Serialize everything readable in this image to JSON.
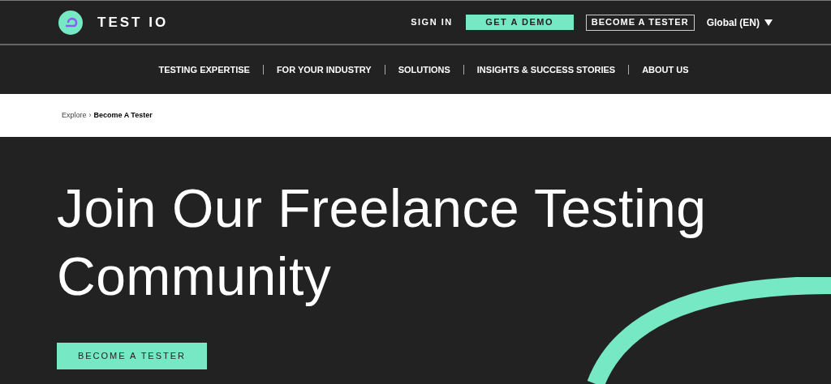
{
  "header": {
    "brand": "TEST IO",
    "sign_in": "SIGN IN",
    "demo_button": "GET A DEMO",
    "tester_button": "BECOME A TESTER",
    "language": "Global (EN)"
  },
  "nav": [
    "TESTING EXPERTISE",
    "FOR YOUR INDUSTRY",
    "SOLUTIONS",
    "INSIGHTS & SUCCESS STORIES",
    "ABOUT US"
  ],
  "breadcrumb": {
    "items": [
      "Explore",
      "Become A Tester"
    ],
    "separator": "›"
  },
  "hero": {
    "title": "Join Our Freelance Testing Community",
    "button": "BECOME A TESTER"
  }
}
